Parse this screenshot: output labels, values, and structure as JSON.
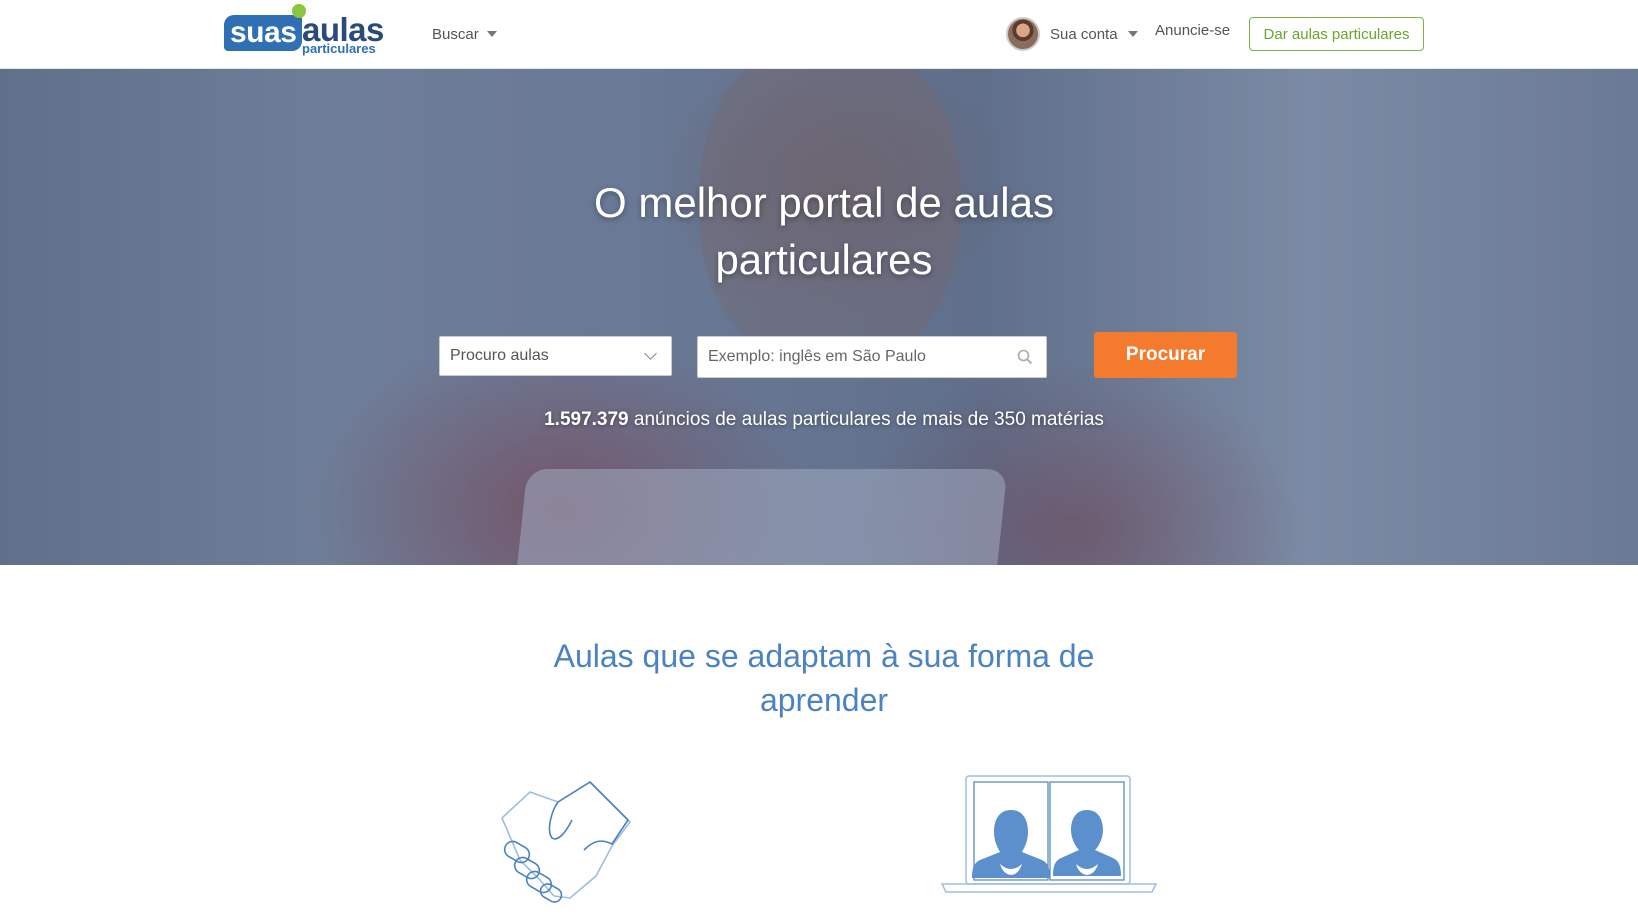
{
  "brand": {
    "logo_suas": "suas",
    "logo_aulas": "aulas",
    "logo_sub": "particulares"
  },
  "header": {
    "buscar_label": "Buscar",
    "account_label": "Sua conta",
    "anuncie_label": "Anuncie-se",
    "dar_aulas_label": "Dar aulas particulares"
  },
  "hero": {
    "title": "O melhor portal de aulas particulares",
    "select_value": "Procuro aulas",
    "search_placeholder": "Exemplo: inglês em São Paulo",
    "search_button": "Procurar",
    "stats_count": "1.597.379",
    "stats_text": "anúncios de aulas particulares de mais de 350 matérias"
  },
  "section": {
    "title": "Aulas que se adaptam à sua forma de aprender"
  },
  "colors": {
    "brand_blue": "#2f6fb3",
    "accent_orange": "#f47a2e",
    "accent_green": "#7fb241",
    "section_blue": "#4a82c3"
  }
}
